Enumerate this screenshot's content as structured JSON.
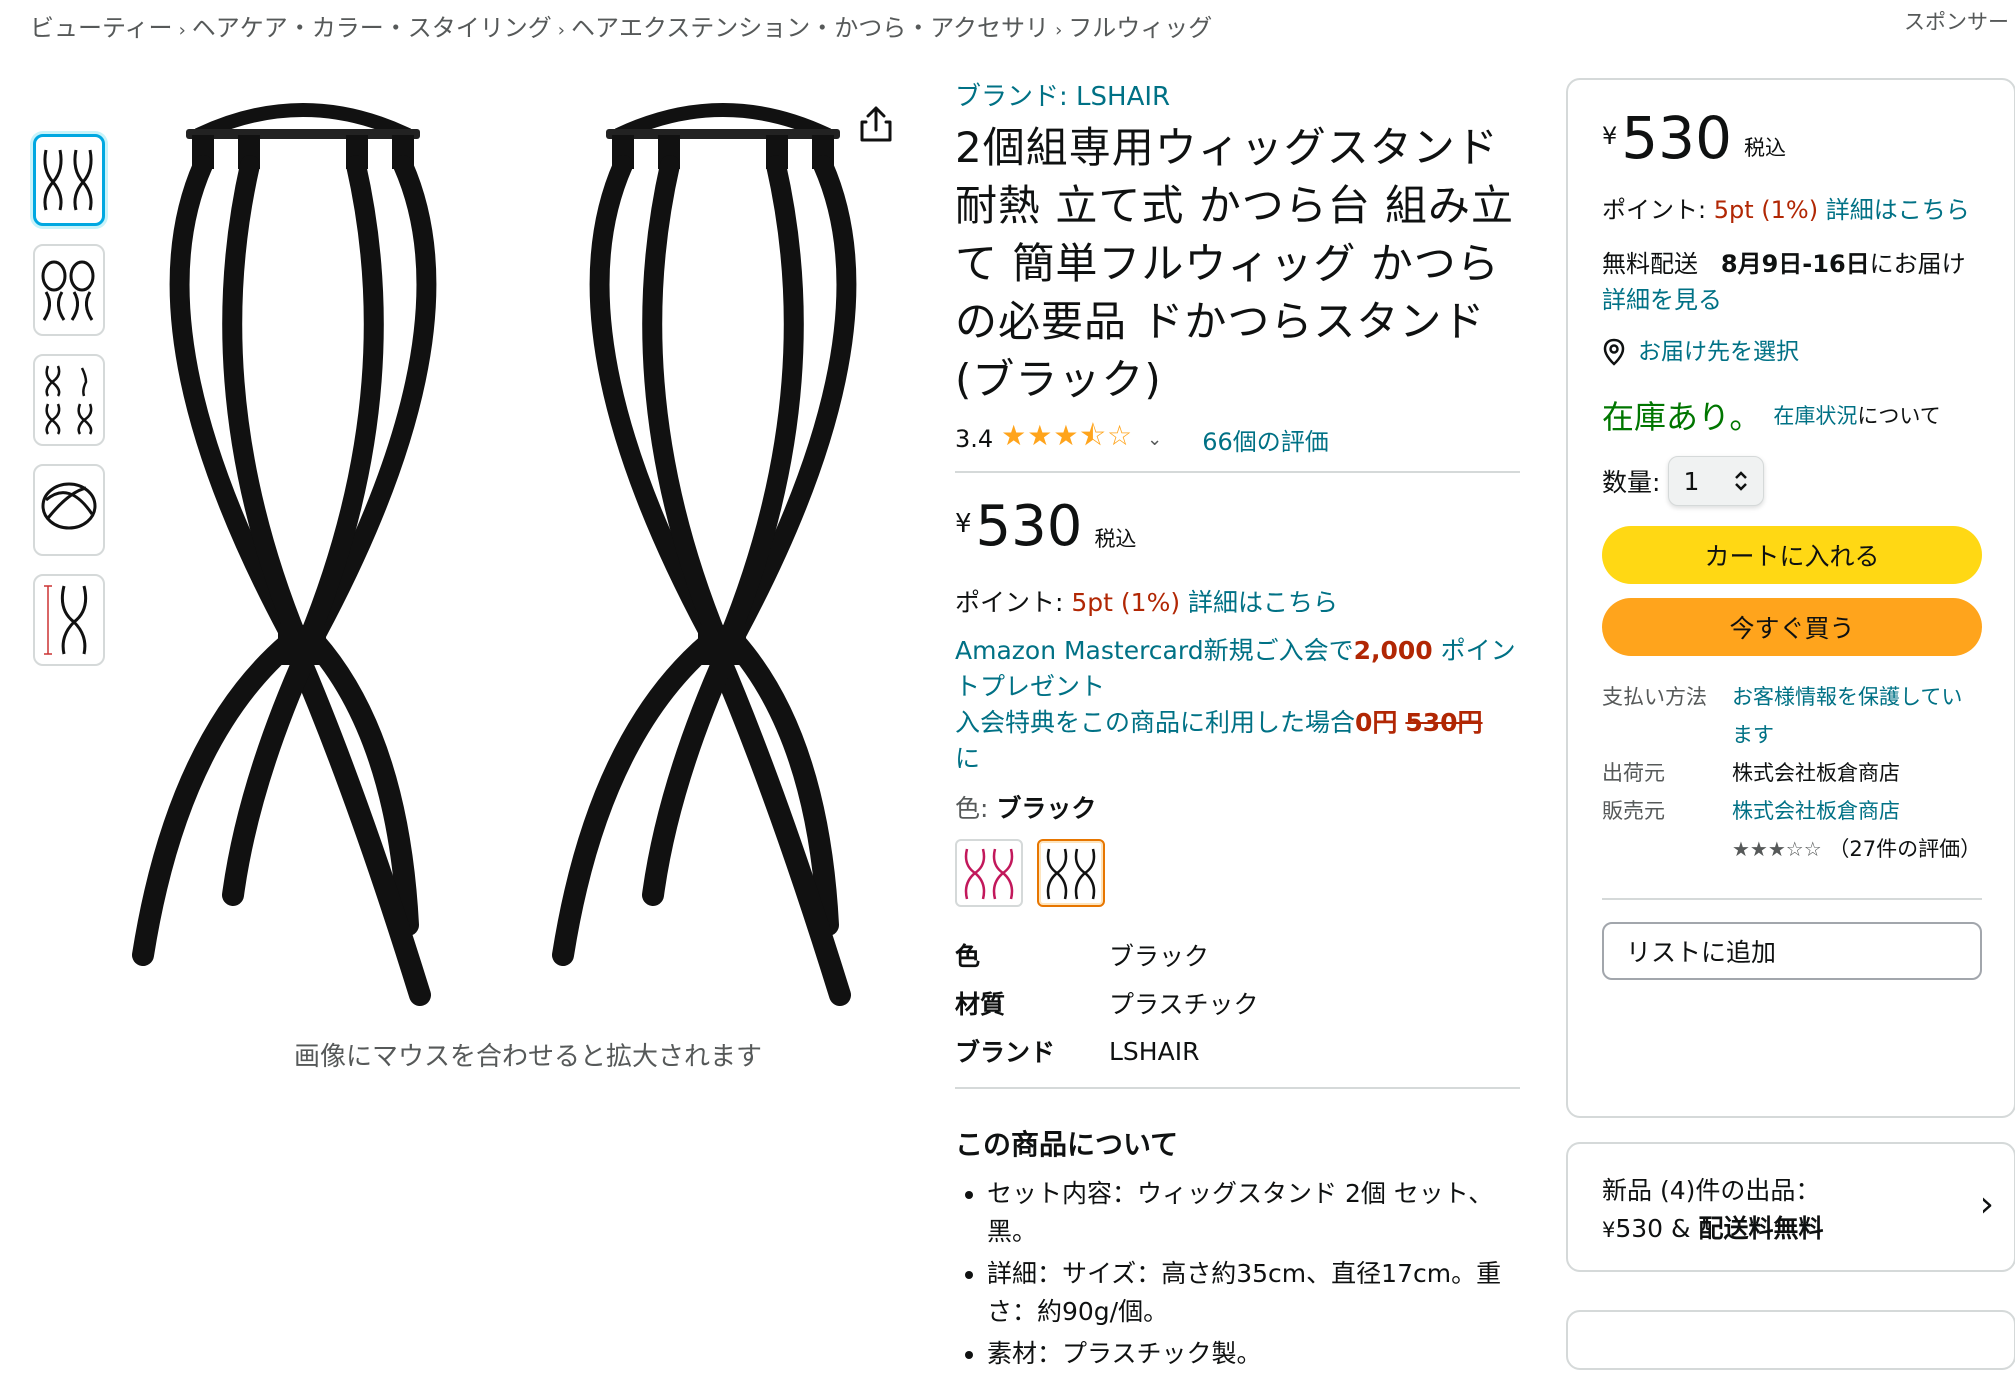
{
  "breadcrumb": [
    "ビューティー",
    "ヘアケア・カラー・スタイリング",
    "ヘアエクステンション・かつら・アクセサリ",
    "フルウィッグ"
  ],
  "sponsor_label": "スポンサー",
  "gallery": {
    "zoom_hint": "画像にマウスを合わせると拡大されます",
    "thumbnail_count": 5
  },
  "product": {
    "brand_link": "ブランド: LSHAIR",
    "title": "2個組専用ウィッグスタンド 耐熱 立て式 かつら台 組み立て 簡単フルウィッグ かつらの必要品 ドかつらスタンド (ブラック)",
    "rating": "3.4",
    "stars": "★★★⯪☆",
    "review_count": "66個の評価",
    "price_symbol": "¥",
    "price": "530",
    "tax_label": "税込",
    "points_label": "ポイント:",
    "points_value": "5pt  (1%)",
    "points_details": "詳細はこちら",
    "promo_line1_prefix": "Amazon Mastercard新規ご入会で",
    "promo_points": "2,000",
    "promo_line1_suffix": " ポイントプレゼント",
    "promo_line2_prefix": "入会特典をこの商品に利用した場合",
    "promo_zero": "0円",
    "promo_original": "530円",
    "promo_line2_suffix": "に",
    "color_label": "色:",
    "color_value": "ブラック",
    "specs": [
      {
        "key": "色",
        "value": "ブラック"
      },
      {
        "key": "材質",
        "value": "プラスチック"
      },
      {
        "key": "ブランド",
        "value": "LSHAIR"
      }
    ],
    "about_heading": "この商品について",
    "about_items": [
      "セット内容：ウィッグスタンド 2個 セット、黑。",
      "詳細：サイズ：高さ約35cm、直径17cm。重さ：約90g/個。",
      "素材：プラスチック製。"
    ]
  },
  "buybox": {
    "price_symbol": "¥",
    "price": "530",
    "tax_label": "税込",
    "points_label": "ポイント:",
    "points_value": "5pt  (1%)",
    "points_details": "詳細はこちら",
    "shipping_label": "無料配送",
    "delivery_date": "8月9日-16日",
    "delivery_suffix": "にお届け",
    "details_link": "詳細を見る",
    "location_link": "お届け先を選択",
    "in_stock": "在庫あり。",
    "stock_link": "在庫状況",
    "stock_suffix": "について",
    "qty_label": "数量:",
    "qty_value": "1",
    "add_to_cart": "カートに入れる",
    "buy_now": "今すぐ買う",
    "payment_label": "支払い方法",
    "payment_value": "お客様情報を保護しています",
    "ships_from_label": "出荷元",
    "ships_from_value": "株式会社板倉商店",
    "sold_by_label": "販売元",
    "sold_by_value": "株式会社板倉商店",
    "seller_stars": "★★★☆☆",
    "seller_reviews": "（27件の評価）",
    "add_to_list": "リストに追加"
  },
  "offers": {
    "line1": "新品 (4)件の出品：",
    "price_symbol": "¥",
    "price": "530",
    "amp": " & ",
    "free_shipping": "配送料無料"
  },
  "colors": {
    "link": "#007185",
    "price_red": "#b12704",
    "in_stock": "#007600",
    "cart_button": "#ffd814",
    "buy_button": "#ffa41c",
    "stars": "#ffa41c"
  }
}
